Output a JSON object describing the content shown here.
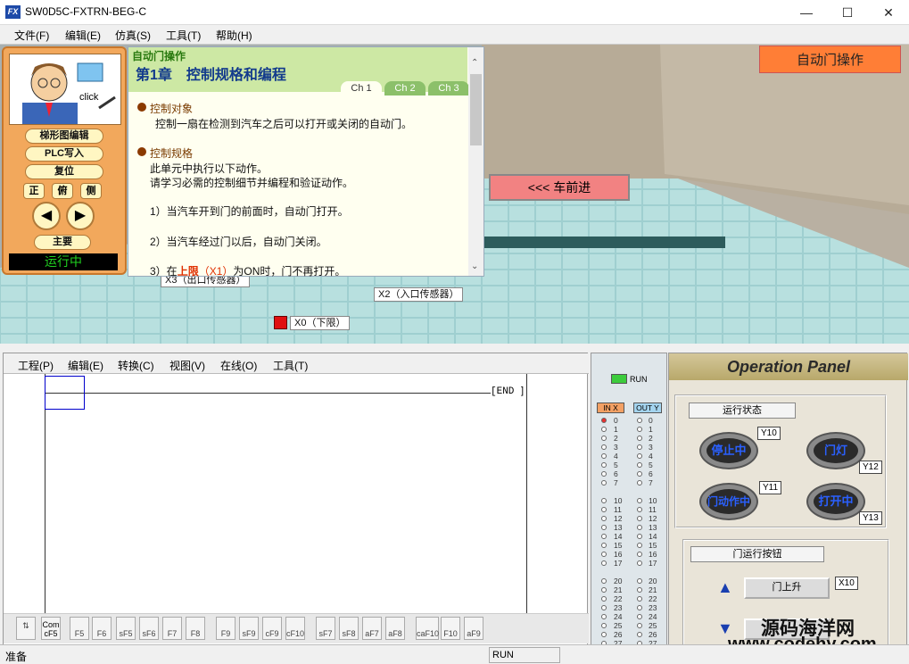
{
  "window": {
    "title": "SW0D5C-FXTRN-BEG-C",
    "logo": "FX"
  },
  "menubar": [
    "文件(F)",
    "编辑(E)",
    "仿真(S)",
    "工具(T)",
    "帮助(H)"
  ],
  "char_panel": {
    "click_label": "click",
    "btn_ladder": "梯形图编辑",
    "btn_plc_write": "PLC写入",
    "btn_reset": "复位",
    "view_front": "正",
    "view_top": "俯",
    "view_side": "侧",
    "btn_main": "主要",
    "run_status": "运行中"
  },
  "instructions": {
    "module": "自动门操作",
    "chapter": "第1章　控制规格和编程",
    "tabs": [
      "Ch 1",
      "Ch 2",
      "Ch 3"
    ],
    "sec1_title": "控制对象",
    "sec1_body": "控制一扇在检测到汽车之后可以打开或关闭的自动门。",
    "sec2_title": "控制规格",
    "sec2_body1": "此单元中执行以下动作。",
    "sec2_body2": "请学习必需的控制细节并编程和验证动作。",
    "step1": "1）当汽车开到门的前面时，自动门打开。",
    "step2": "2）当汽车经过门以后，自动门关闭。",
    "step3_a": "3）在",
    "step3_b": "上限",
    "step3_c": "（X1）",
    "step3_d": "为ON时，门不再打开。"
  },
  "scene": {
    "op_badge": "自动门操作",
    "car_forward": "<<<  车前进",
    "x3_label": "X3（出口传感器）",
    "x2_label": "X2（入口传感器）",
    "x0_label": "X0（下限）"
  },
  "ladder": {
    "menu": [
      "工程(P)",
      "编辑(E)",
      "转换(C)",
      "视图(V)",
      "在线(O)",
      "工具(T)"
    ],
    "end_label": "[END",
    "fkeys": [
      "F5",
      "F6",
      "sF5",
      "sF6",
      "F7",
      "F8",
      "F9",
      "sF9",
      "cF9",
      "cF10",
      "sF7",
      "sF8",
      "aF7",
      "aF8",
      "caF10",
      "F10",
      "aF9"
    ],
    "com_key": "Com\ncF5"
  },
  "io": {
    "run_label": "RUN",
    "in_header": "IN X",
    "out_header": "OUT Y",
    "numbers": [
      "0",
      "1",
      "2",
      "3",
      "4",
      "5",
      "6",
      "7",
      "10",
      "11",
      "12",
      "13",
      "14",
      "15",
      "16",
      "17",
      "20",
      "21",
      "22",
      "23",
      "24",
      "25",
      "26",
      "27"
    ],
    "x_on": [
      0
    ]
  },
  "op_panel": {
    "title": "Operation Panel",
    "group1": "运行状态",
    "lamps": [
      {
        "label": "停止中",
        "tag": "Y10"
      },
      {
        "label": "门灯",
        "tag": "Y12"
      },
      {
        "label": "门动作中",
        "tag": "Y11"
      },
      {
        "label": "打开中",
        "tag": "Y13"
      }
    ],
    "group2": "门运行按钮",
    "btn_up": "门上升",
    "btn_up_tag": "X10"
  },
  "status": {
    "left": "准备",
    "mode": "RUN"
  },
  "watermark": {
    "line1": "源码海洋网",
    "line2": "www.codehy.com"
  }
}
